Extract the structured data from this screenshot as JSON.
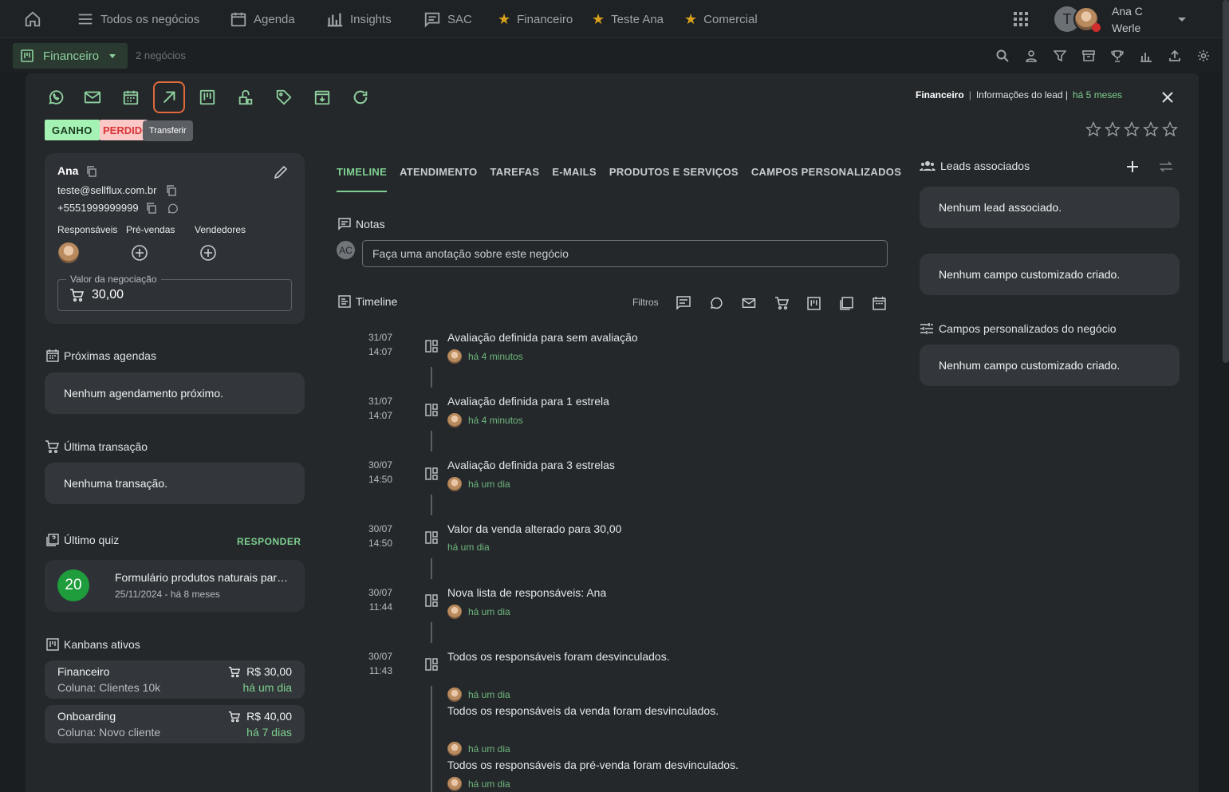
{
  "nav": {
    "items": [
      {
        "label": "Todos os negócios",
        "icon": "list-icon"
      },
      {
        "label": "Agenda",
        "icon": "calendar-icon"
      },
      {
        "label": "Insights",
        "icon": "bar-chart-icon"
      },
      {
        "label": "SAC",
        "icon": "chat-icon"
      },
      {
        "label": "Financeiro",
        "icon": "star-icon"
      },
      {
        "label": "Teste Ana",
        "icon": "star-icon"
      },
      {
        "label": "Comercial",
        "icon": "star-icon"
      }
    ],
    "avatar_initial": "T",
    "user_first": "Ana C",
    "user_last": "Werle"
  },
  "subbar": {
    "board": "Financeiro",
    "count": "2 negócios"
  },
  "modal": {
    "tags": {
      "won": "GANHO",
      "lost": "PERDIDO"
    },
    "tooltip": "Transferir",
    "breadcrumb": {
      "board": "Financeiro",
      "section": "Informações do lead |",
      "time": "há 5 meses"
    },
    "lead": {
      "name": "Ana",
      "email": "teste@sellflux.com.br",
      "phone": "+5551999999999",
      "roles": [
        "Responsáveis",
        "Pré-vendas",
        "Vendedores"
      ],
      "value_label": "Valor da negociação",
      "value": "30,00"
    },
    "agenda": {
      "title": "Próximas agendas",
      "empty": "Nenhum agendamento próximo."
    },
    "transaction": {
      "title": "Última transação",
      "empty": "Nenhuma transação."
    },
    "quiz": {
      "title": "Último quiz",
      "action": "RESPONDER",
      "score": "20",
      "name": "Formulário produtos naturais para sua saúde",
      "date": "25/11/2024 - há 8 meses"
    },
    "kanbans": {
      "title": "Kanbans ativos",
      "items": [
        {
          "name": "Financeiro",
          "column": "Coluna: Clientes 10k",
          "value": "R$ 30,00",
          "time": "há um dia"
        },
        {
          "name": "Onboarding",
          "column": "Coluna: Novo cliente",
          "value": "R$ 40,00",
          "time": "há 7 dias"
        }
      ]
    },
    "tabs": [
      "TIMELINE",
      "ATENDIMENTO",
      "TAREFAS",
      "E-MAILS",
      "PRODUTOS E SERVIÇOS",
      "CAMPOS PERSONALIZADOS"
    ],
    "notes": {
      "title": "Notas",
      "avatar": "AC",
      "placeholder": "Faça uma anotação sobre este negócio"
    },
    "timeline": {
      "title": "Timeline",
      "filters_label": "Filtros",
      "events": [
        {
          "date": "31/07",
          "time": "14:07",
          "text": "Avaliação definida para sem avaliação",
          "ago": "há 4 minutos"
        },
        {
          "date": "31/07",
          "time": "14:07",
          "text": "Avaliação definida para 1 estrela",
          "ago": "há 4 minutos"
        },
        {
          "date": "30/07",
          "time": "14:50",
          "text": "Avaliação definida para 3 estrelas",
          "ago": "há um dia"
        },
        {
          "date": "30/07",
          "time": "14:50",
          "text": "Valor da venda alterado para 30,00",
          "ago": "há um dia"
        },
        {
          "date": "30/07",
          "time": "11:44",
          "text": "Nova lista de responsáveis: Ana",
          "ago": "há um dia"
        },
        {
          "date": "30/07",
          "time": "11:43",
          "text": "Todos os responsáveis foram desvinculados.",
          "ago": "há um dia"
        }
      ],
      "extra": [
        {
          "text": "Todos os responsáveis da venda foram desvinculados.",
          "ago": "há um dia"
        },
        {
          "text": "Todos os responsáveis da pré-venda foram desvinculados.",
          "ago": "há um dia"
        }
      ]
    },
    "right": {
      "leads_title": "Leads associados",
      "leads_empty": "Nenhum lead associado.",
      "custom_empty": "Nenhum campo customizado criado.",
      "deal_fields_title": "Campos personalizados do negócio",
      "deal_fields_empty": "Nenhum campo customizado criado."
    }
  }
}
